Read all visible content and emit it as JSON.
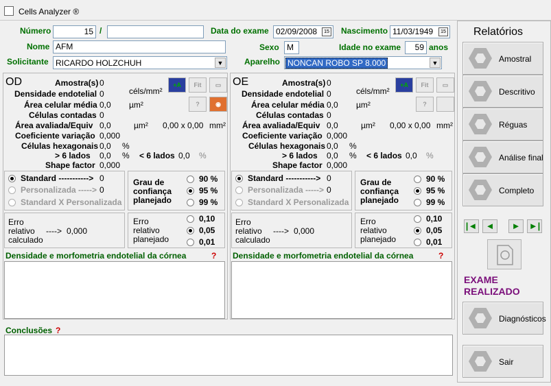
{
  "window": {
    "title": "Cells Analyzer ®"
  },
  "header": {
    "numero_label": "Número",
    "numero_value": "15",
    "numero_sep": "/",
    "numero_suffix": "",
    "data_exame_label": "Data do exame",
    "data_exame_value": "02/09/2008",
    "nascimento_label": "Nascimento",
    "nascimento_value": "11/03/1949",
    "nome_label": "Nome",
    "nome_value": "AFM",
    "sexo_label": "Sexo",
    "sexo_value": "M",
    "idade_label": "Idade no exame",
    "idade_value": "59",
    "idade_unit": "anos",
    "solicitante_label": "Solicitante",
    "solicitante_value": "RICARDO HOLZCHUH",
    "aparelho_label": "Aparelho",
    "aparelho_value": "NONCAN ROBO SP 8.000"
  },
  "eyes": [
    {
      "name": "OD",
      "amostras_label": "Amostra(s)",
      "amostras": "0",
      "dens_label": "Densidade endotelial",
      "dens": "0",
      "dens_unit": "céls/mm²",
      "area_label": "Área celular média",
      "area": "0,0",
      "area_unit": "µm²",
      "contadas_label": "Células contadas",
      "contadas": "0",
      "aval_label": "Área avaliada/Equiv",
      "aval": "0,0",
      "aval_unit": "µm²",
      "aval_dim": "0,00 x 0,00",
      "aval_unit2": "mm²",
      "coef_label": "Coeficiente variação",
      "coef": "0,000",
      "hex_label": "Células hexagonais",
      "hex": "0,0",
      "hex_unit": "%",
      "gt6_label": "> 6 lados",
      "gt6": "0,0",
      "gt6_unit": "%",
      "lt6_label": "< 6 lados",
      "lt6": "0,0",
      "lt6_unit": "%",
      "shape_label": "Shape factor",
      "shape": "0,000",
      "standard_label": "Standard ----------->",
      "standard_val": "0",
      "personal_label": "Personalizada ----->",
      "personal_val": "0",
      "stdxpers_label": "Standard X Personalizada",
      "grau_label": "Grau de confiança planejado",
      "grau_options": [
        "90 %",
        "95 %",
        "99 %"
      ],
      "grau_selected": "95 %",
      "erro_calc_label": "Erro relativo calculado",
      "erro_arrow": "---->",
      "erro_calc": "0,000",
      "erro_plan_label": "Erro relativo planejado",
      "erro_options": [
        "0,10",
        "0,05",
        "0,01"
      ],
      "erro_selected": "0,05",
      "morf_label": "Densidade e morfometria endotelial da córnea",
      "help": "?"
    },
    {
      "name": "OE",
      "amostras_label": "Amostra(s)",
      "amostras": "0",
      "dens_label": "Densidade endotelial",
      "dens": "0",
      "dens_unit": "céls/mm²",
      "area_label": "Área celular média",
      "area": "0,0",
      "area_unit": "µm²",
      "contadas_label": "Células contadas",
      "contadas": "0",
      "aval_label": "Área avaliada/Equiv",
      "aval": "0,0",
      "aval_unit": "µm²",
      "aval_dim": "0,00 x 0,00",
      "aval_unit2": "mm²",
      "coef_label": "Coeficiente variação",
      "coef": "0,000",
      "hex_label": "Células hexagonais",
      "hex": "0,0",
      "hex_unit": "%",
      "gt6_label": "> 6 lados",
      "gt6": "0,0",
      "gt6_unit": "%",
      "lt6_label": "< 6 lados",
      "lt6": "0,0",
      "lt6_unit": "%",
      "shape_label": "Shape factor",
      "shape": "0,000",
      "standard_label": "Standard ----------->",
      "standard_val": "0",
      "personal_label": "Personalizada ----->",
      "personal_val": "0",
      "stdxpers_label": "Standard X Personalizada",
      "grau_label": "Grau de confiança planejado",
      "grau_options": [
        "90 %",
        "95 %",
        "99 %"
      ],
      "grau_selected": "95 %",
      "erro_calc_label": "Erro relativo calculado",
      "erro_arrow": "---->",
      "erro_calc": "0,000",
      "erro_plan_label": "Erro relativo planejado",
      "erro_options": [
        "0,10",
        "0,05",
        "0,01"
      ],
      "erro_selected": "0,05",
      "morf_label": "Densidade e morfometria endotelial da córnea",
      "help": "?"
    }
  ],
  "toolbar": {
    "add_label": "+A",
    "fit_label": "Fit",
    "help": "?"
  },
  "conclusoes": {
    "label": "Conclusões",
    "help": "?"
  },
  "relatorios": {
    "title": "Relatórios",
    "buttons": [
      "Amostral",
      "Descritivo",
      "Réguas",
      "Análise final",
      "Completo"
    ],
    "nav": [
      "|◄",
      "◄",
      "►",
      "►|"
    ],
    "status": "EXAME REALIZADO",
    "diagnosticos": "Diagnósticos",
    "sair": "Sair"
  },
  "colors": {
    "label_green": "#007000",
    "status_purple": "#7a0e7a",
    "help_red": "#cc0000"
  }
}
